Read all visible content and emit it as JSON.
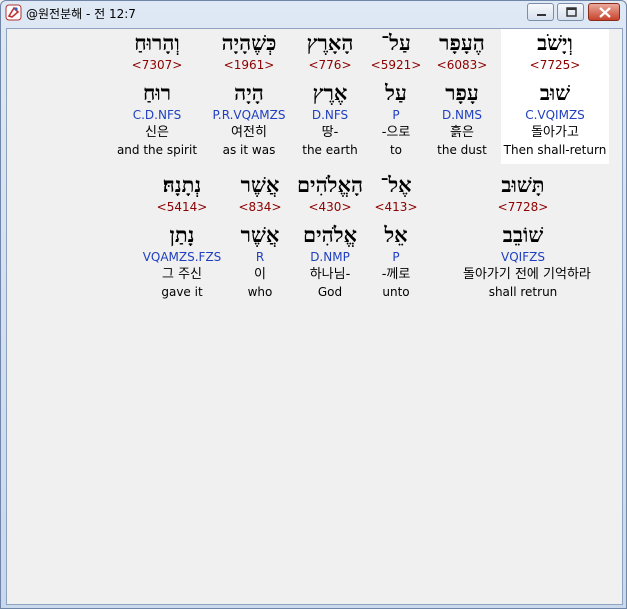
{
  "window": {
    "title": "@원전분해 - 전 12:7",
    "icon": "app-logo-icon",
    "controls": [
      "minimize-icon",
      "maximize-icon",
      "close-icon"
    ]
  },
  "colors": {
    "strong_number": "#8b0000",
    "parsing": "#1f3fbf",
    "selected_background": "#ffffff"
  },
  "line1": [
    {
      "hebrew": "וְיָשֹׁב",
      "strong": "<7725>",
      "root": "שׁוּב",
      "parsing": "C.VQIMZS",
      "korean": "돌아가고",
      "english": "Then shall-return",
      "selected": true
    },
    {
      "hebrew": "הֶעָפָר",
      "strong": "<6083>",
      "root": "עָפָר",
      "parsing": "D.NMS",
      "korean": "흙은",
      "english": "the dust"
    },
    {
      "hebrew": "עַל־",
      "strong": "<5921>",
      "root": "עַל",
      "parsing": "P",
      "korean": "-으로",
      "english": "to"
    },
    {
      "hebrew": "הָאָרֶץ",
      "strong": "<776>",
      "root": "אֶרֶץ",
      "parsing": "D.NFS",
      "korean": "땅-",
      "english": "the earth"
    },
    {
      "hebrew": "כְּשֶׁהָיָה",
      "strong": "<1961>",
      "root": "הָיָה",
      "parsing": "P.R.VQAMZS",
      "korean": "여전히",
      "english": "as it was"
    },
    {
      "hebrew": "וְהָרוּחַ",
      "strong": "<7307>",
      "root": "רוּחַ",
      "parsing": "C.D.NFS",
      "korean": "신은",
      "english": "and the spirit"
    }
  ],
  "line2": [
    {
      "hebrew": "תָּשׁוּב",
      "strong": "<7728>",
      "root": "שׁוֹבֵב",
      "parsing": "VQIFZS",
      "korean": "돌아가기 전에 기억하라",
      "english": "shall retrun"
    },
    {
      "hebrew": "אֶל־",
      "strong": "<413>",
      "root": "אֵל",
      "parsing": "P",
      "korean": "-께로",
      "english": "unto"
    },
    {
      "hebrew": "הָאֱלֹהִים",
      "strong": "<430>",
      "root": "אֱלֹהִים",
      "parsing": "D.NMP",
      "korean": "하나님-",
      "english": "God"
    },
    {
      "hebrew": "אֲשֶׁר",
      "strong": "<834>",
      "root": "אֲשֶׁר",
      "parsing": "R",
      "korean": "이",
      "english": "who"
    },
    {
      "hebrew": "נְתָנָהּ׃",
      "strong": "<5414>",
      "root": "נָתַן",
      "parsing": "VQAMZS.FZS",
      "korean": "그 주신",
      "english": "gave it"
    }
  ]
}
